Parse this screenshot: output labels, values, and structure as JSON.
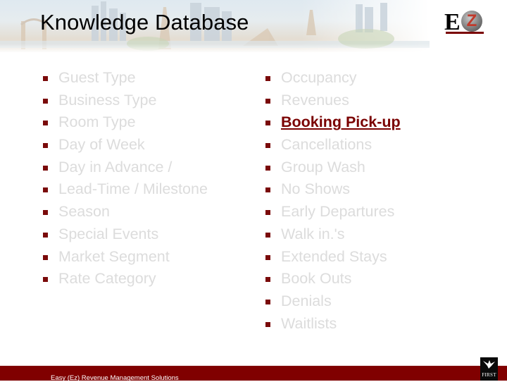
{
  "header": {
    "title": "Knowledge Database",
    "logo_letters": {
      "e": "E",
      "z": "Z"
    }
  },
  "left_list": [
    {
      "label": "Guest Type",
      "active": false
    },
    {
      "label": "Business Type",
      "active": false
    },
    {
      "label": "Room Type",
      "active": false
    },
    {
      "label": "Day of Week",
      "active": false
    },
    {
      "label": "Day in Advance /",
      "active": false
    },
    {
      "label": "Lead-Time / Milestone",
      "active": false
    },
    {
      "label": "Season",
      "active": false
    },
    {
      "label": "Special Events",
      "active": false
    },
    {
      "label": "Market Segment",
      "active": false
    },
    {
      "label": "Rate Category",
      "active": false
    }
  ],
  "right_list": [
    {
      "label": "Occupancy",
      "active": false
    },
    {
      "label": "Revenues",
      "active": false
    },
    {
      "label": "Booking Pick-up",
      "active": true
    },
    {
      "label": "Cancellations",
      "active": false
    },
    {
      "label": "Group Wash",
      "active": false
    },
    {
      "label": "No Shows",
      "active": false
    },
    {
      "label": "Early Departures",
      "active": false
    },
    {
      "label": "Walk in.'s",
      "active": false
    },
    {
      "label": "Extended Stays",
      "active": false
    },
    {
      "label": "Book Outs",
      "active": false
    },
    {
      "label": "Denials",
      "active": false
    },
    {
      "label": "Waitlists",
      "active": false
    }
  ],
  "footer": {
    "text": "Easy (Ez) Revenue Management Solutions",
    "partner_logo_text": "FIRST"
  },
  "colors": {
    "accent": "#800000",
    "bullet": "#7a0a0a",
    "item_text": "#dcdcdc",
    "active_text": "#7a0000"
  }
}
